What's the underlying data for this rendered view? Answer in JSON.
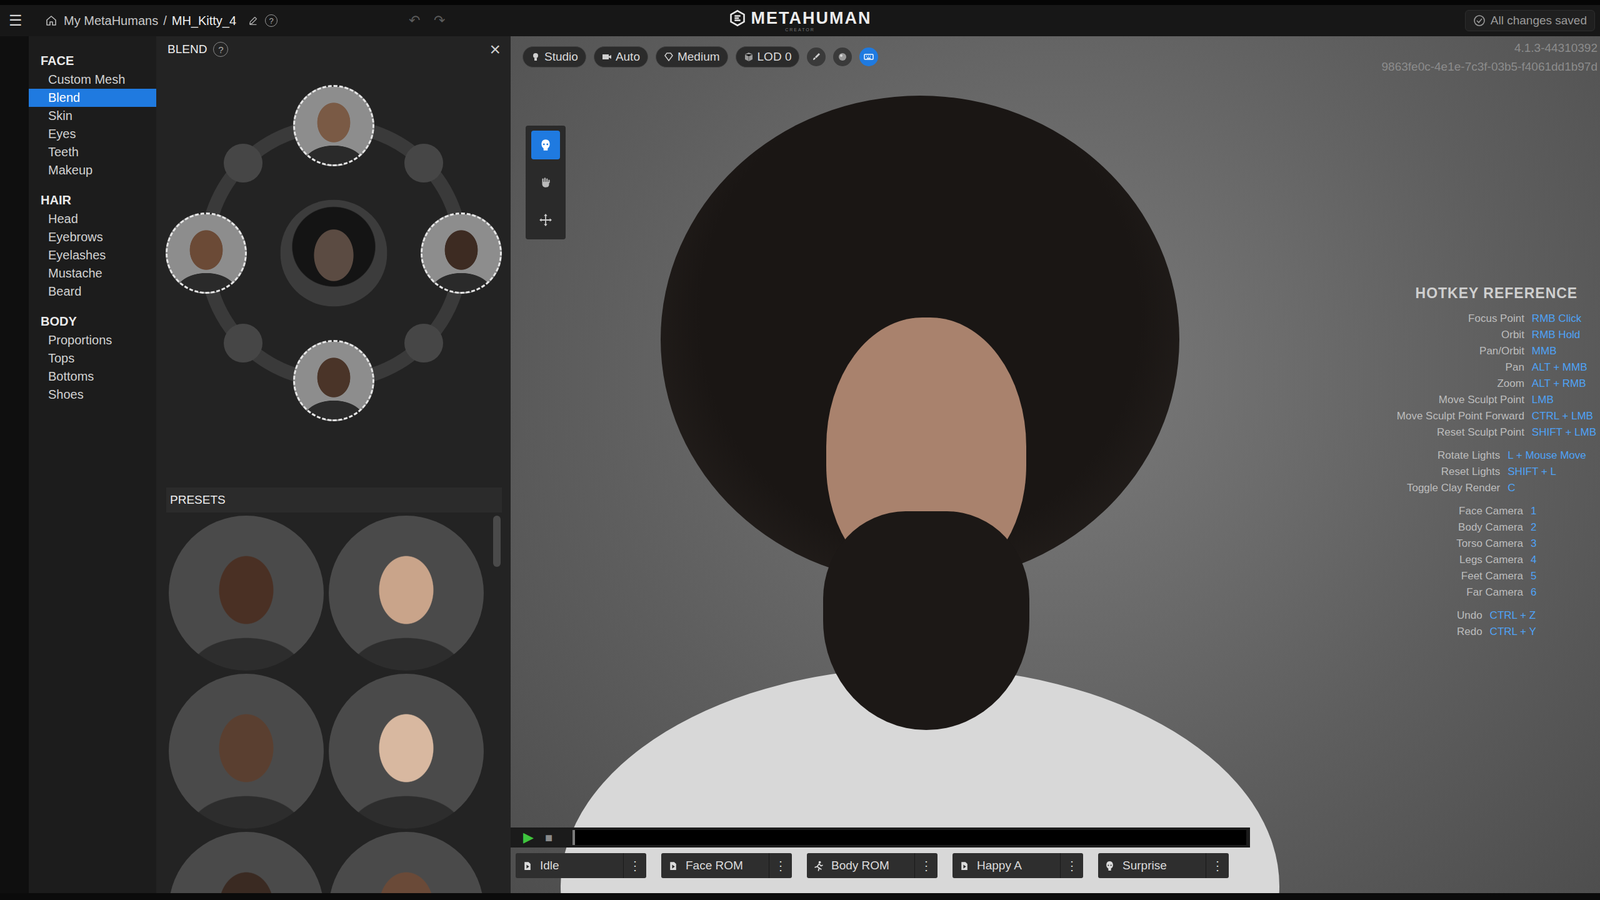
{
  "topbar": {
    "menu": "☰",
    "breadcrumb": {
      "root": "My MetaHumans",
      "separator": "/",
      "current": "MH_Kitty_4"
    },
    "help": "?",
    "undo": {
      "glyph": "↶",
      "disabled": true
    },
    "redo": {
      "glyph": "↷",
      "disabled": true
    },
    "logo": {
      "title": "METAHUMAN",
      "subtitle": "CREATOR"
    },
    "status": "All changes saved"
  },
  "sidebar": {
    "sections": [
      {
        "title": "FACE",
        "items": [
          {
            "label": "Custom Mesh",
            "selected": false
          },
          {
            "label": "Blend",
            "selected": true
          },
          {
            "label": "Skin",
            "selected": false
          },
          {
            "label": "Eyes",
            "selected": false
          },
          {
            "label": "Teeth",
            "selected": false
          },
          {
            "label": "Makeup",
            "selected": false
          }
        ]
      },
      {
        "title": "HAIR",
        "items": [
          {
            "label": "Head",
            "selected": false
          },
          {
            "label": "Eyebrows",
            "selected": false
          },
          {
            "label": "Eyelashes",
            "selected": false
          },
          {
            "label": "Mustache",
            "selected": false
          },
          {
            "label": "Beard",
            "selected": false
          }
        ]
      },
      {
        "title": "BODY",
        "items": [
          {
            "label": "Proportions",
            "selected": false
          },
          {
            "label": "Tops",
            "selected": false
          },
          {
            "label": "Bottoms",
            "selected": false
          },
          {
            "label": "Shoes",
            "selected": false
          }
        ]
      }
    ]
  },
  "panel": {
    "title": "BLEND",
    "help": "?",
    "close": "×",
    "center": {
      "color": "#5b4b42"
    },
    "slots": [
      {
        "filled": true,
        "color": "#7a5a45"
      },
      {
        "filled": false,
        "color": "#454545"
      },
      {
        "filled": true,
        "color": "#3d2b22"
      },
      {
        "filled": false,
        "color": "#454545"
      },
      {
        "filled": true,
        "color": "#4a3428"
      },
      {
        "filled": false,
        "color": "#454545"
      },
      {
        "filled": true,
        "color": "#6b4a36"
      },
      {
        "filled": false,
        "color": "#454545"
      }
    ],
    "presets": {
      "title": "PRESETS",
      "items": [
        {
          "color": "#4a3024"
        },
        {
          "color": "#c9a48a"
        },
        {
          "color": "#5a3f30"
        },
        {
          "color": "#d8b8a0"
        },
        {
          "color": "#3a2a22"
        },
        {
          "color": "#6a4a38"
        }
      ]
    }
  },
  "viewport": {
    "toolbar": [
      {
        "label": "Studio",
        "kind": "light"
      },
      {
        "label": "Auto",
        "kind": "camera"
      },
      {
        "label": "Medium",
        "kind": "quality"
      },
      {
        "label": "LOD 0",
        "kind": "lod"
      }
    ],
    "toggles": [
      {
        "kind": "brush",
        "selected": false
      },
      {
        "kind": "sphere",
        "selected": false
      },
      {
        "kind": "keyboard",
        "selected": true
      }
    ],
    "tools": [
      {
        "kind": "face",
        "selected": true
      },
      {
        "kind": "grab",
        "selected": false
      },
      {
        "kind": "move",
        "selected": false
      }
    ],
    "version": "4.1.3-44310392",
    "build_id": "9863fe0c-4e1e-7c3f-03b5-f4061dd1b97d"
  },
  "hotkeys": {
    "title": "HOTKEY REFERENCE",
    "groups": [
      [
        {
          "action": "Focus Point",
          "keys": "RMB Click"
        },
        {
          "action": "Orbit",
          "keys": "RMB Hold"
        },
        {
          "action": "Pan/Orbit",
          "keys": "MMB"
        },
        {
          "action": "Pan",
          "keys": "ALT + MMB"
        },
        {
          "action": "Zoom",
          "keys": "ALT + RMB"
        },
        {
          "action": "Move Sculpt Point",
          "keys": "LMB"
        },
        {
          "action": "Move Sculpt Point Forward",
          "keys": "CTRL + LMB"
        },
        {
          "action": "Reset Sculpt Point",
          "keys": "SHIFT + LMB"
        }
      ],
      [
        {
          "action": "Rotate Lights",
          "keys": "L + Mouse Move"
        },
        {
          "action": "Reset Lights",
          "keys": "SHIFT + L"
        },
        {
          "action": "Toggle Clay Render",
          "keys": "C"
        }
      ],
      [
        {
          "action": "Face Camera",
          "keys": "1"
        },
        {
          "action": "Body Camera",
          "keys": "2"
        },
        {
          "action": "Torso Camera",
          "keys": "3"
        },
        {
          "action": "Legs Camera",
          "keys": "4"
        },
        {
          "action": "Feet Camera",
          "keys": "5"
        },
        {
          "action": "Far Camera",
          "keys": "6"
        }
      ],
      [
        {
          "action": "Undo",
          "keys": "CTRL + Z"
        },
        {
          "action": "Redo",
          "keys": "CTRL + Y"
        }
      ]
    ]
  },
  "timeline": {
    "play": "▶",
    "stop": "■",
    "level": 0,
    "clips": [
      {
        "label": "Idle",
        "kind": "play",
        "menu": "⋮"
      },
      {
        "label": "Face ROM",
        "kind": "play",
        "menu": "⋮"
      },
      {
        "label": "Body ROM",
        "kind": "body",
        "menu": "⋮"
      },
      {
        "label": "Happy A",
        "kind": "play",
        "menu": "⋮"
      },
      {
        "label": "Surprise",
        "kind": "face",
        "menu": "⋮"
      }
    ]
  }
}
